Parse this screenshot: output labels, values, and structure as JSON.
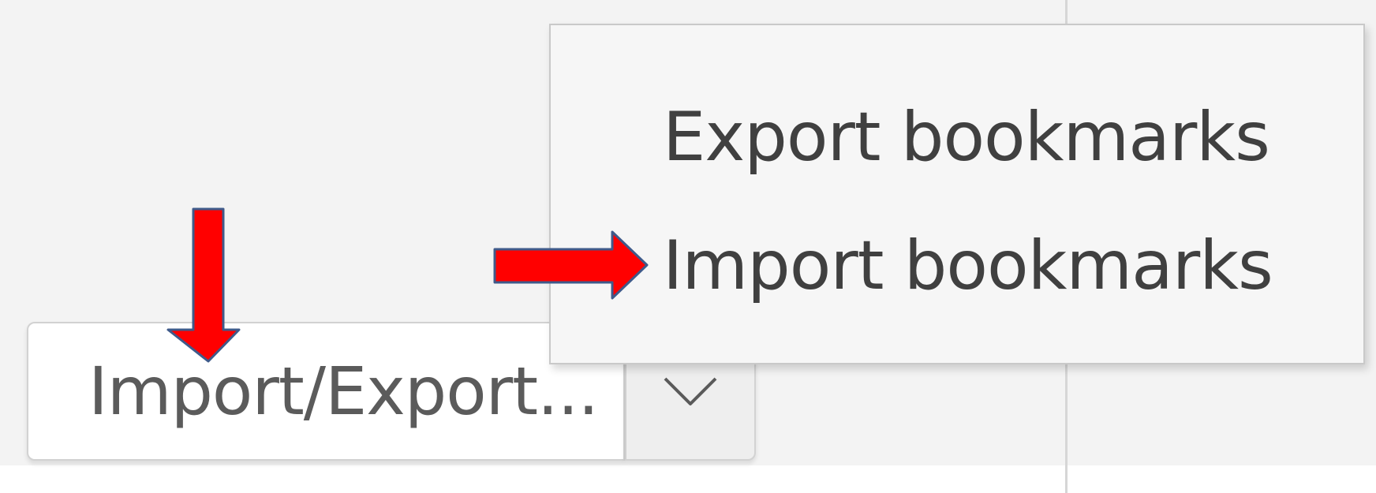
{
  "split_button": {
    "label": "Import/Export..."
  },
  "menu": {
    "items": [
      {
        "label": "Export bookmarks"
      },
      {
        "label": "Import bookmarks"
      }
    ]
  },
  "icons": {
    "dropdown": "chevron-down-icon",
    "annotation_down": "red-arrow-down-icon",
    "annotation_right": "red-arrow-right-icon"
  },
  "colors": {
    "annotation_fill": "#ff0000",
    "annotation_stroke": "#3f5a8a",
    "menu_background": "#f6f6f6",
    "button_background": "#ffffff"
  }
}
